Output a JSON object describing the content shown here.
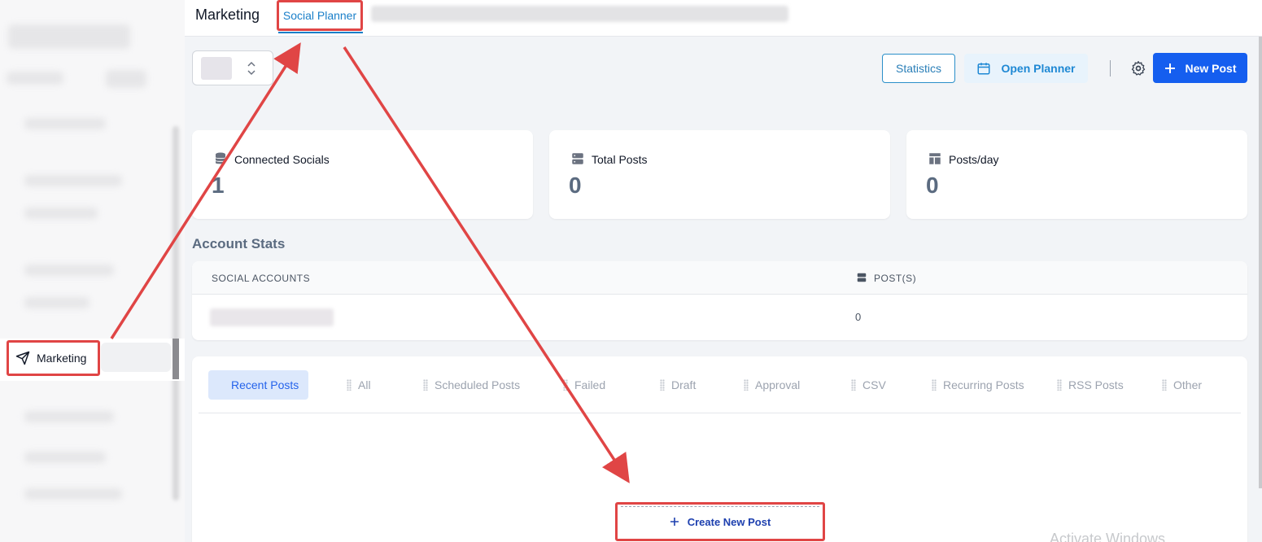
{
  "sidebar": {
    "active_item": {
      "label": "Marketing",
      "icon": "send-icon"
    }
  },
  "topbar": {
    "title": "Marketing",
    "active_tab": "Social Planner"
  },
  "toolbar": {
    "statistics_label": "Statistics",
    "open_planner_label": "Open Planner",
    "new_post_label": "New Post"
  },
  "cards": [
    {
      "label": "Connected Socials",
      "value": "1",
      "icon": "database-icon"
    },
    {
      "label": "Total Posts",
      "value": "0",
      "icon": "server-icon"
    },
    {
      "label": "Posts/day",
      "value": "0",
      "icon": "layout-icon"
    }
  ],
  "account_stats": {
    "title": "Account Stats",
    "columns": [
      "SOCIAL ACCOUNTS",
      "POST(S)"
    ],
    "rows": [
      {
        "posts": "0"
      }
    ]
  },
  "posts_tabs": [
    "Recent Posts",
    "All",
    "Scheduled Posts",
    "Failed",
    "Draft",
    "Approval",
    "CSV",
    "Recurring Posts",
    "RSS Posts",
    "Other"
  ],
  "create_post_label": "Create New Post",
  "watermark": "Activate Windows",
  "colors": {
    "primary": "#155eef",
    "accent": "#1a7fc9",
    "annotation": "#e04545"
  }
}
